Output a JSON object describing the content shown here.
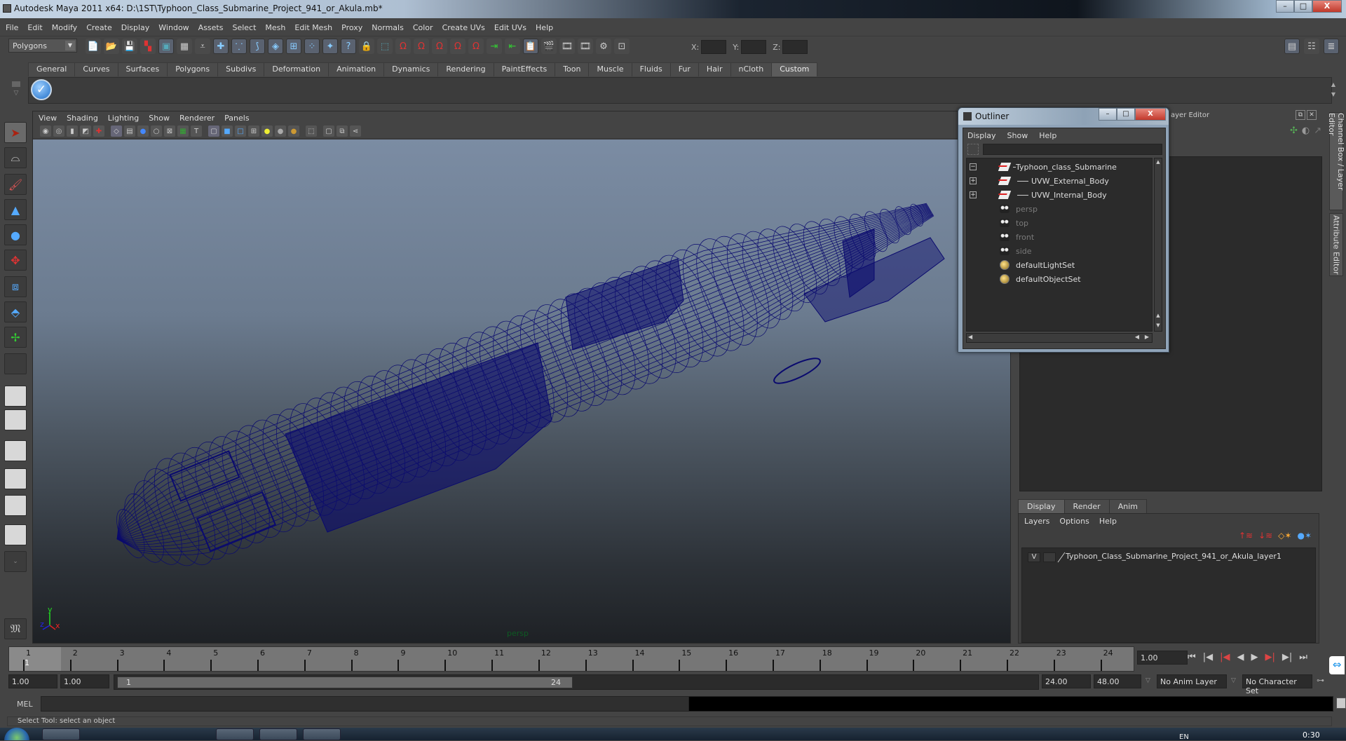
{
  "window": {
    "title": "Autodesk Maya 2011 x64: D:\\1ST\\Typhoon_Class_Submarine_Project_941_or_Akula.mb*",
    "controls": {
      "minimize": "–",
      "maximize": "□",
      "close": "X"
    }
  },
  "menubar": [
    "File",
    "Edit",
    "Modify",
    "Create",
    "Display",
    "Window",
    "Assets",
    "Select",
    "Mesh",
    "Edit Mesh",
    "Proxy",
    "Normals",
    "Color",
    "Create UVs",
    "Edit UVs",
    "Help"
  ],
  "statusline": {
    "mode": "Polygons",
    "icons": [
      "new-scene-icon",
      "open-scene-icon",
      "save-scene-icon",
      "select-by-hierarchy-icon",
      "select-by-object-icon",
      "select-by-component-icon",
      "snap-mode-icon",
      "cross-icon",
      "vertex-icon",
      "curve-icon",
      "face-icon",
      "grid-icon",
      "dots-icon",
      "particle-icon",
      "help-icon",
      "lock-icon",
      "selection-mask-icon",
      "snap-grid-icon",
      "snap-curve-icon",
      "snap-point-icon",
      "snap-view-plane-icon",
      "snap-live-icon",
      "input-ops-icon",
      "output-ops-icon",
      "history-icon",
      "render-view-icon",
      "render-frame-icon",
      "ipr-render-icon",
      "render-settings-icon"
    ],
    "xyz": {
      "x_label": "X:",
      "y_label": "Y:",
      "z_label": "Z:",
      "x": "",
      "y": "",
      "z": ""
    }
  },
  "shelf": {
    "tabs": [
      "General",
      "Curves",
      "Surfaces",
      "Polygons",
      "Subdivs",
      "Deformation",
      "Animation",
      "Dynamics",
      "Rendering",
      "PaintEffects",
      "Toon",
      "Muscle",
      "Fluids",
      "Fur",
      "Hair",
      "nCloth",
      "Custom"
    ],
    "active_tab": "Custom",
    "items": [
      "checkmark-script-icon"
    ]
  },
  "toolbox": {
    "tools": [
      "select-tool",
      "lasso-tool",
      "paint-select-tool",
      "move-tool",
      "rotate-tool",
      "scale-tool",
      "universal-manipulator",
      "soft-modify-tool",
      "show-manipulator",
      "last-tool"
    ],
    "layouts": [
      "single-perspective",
      "four-view",
      "persp-outliner",
      "persp-graph",
      "hypershade-persp",
      "persp-graph-hypergraph"
    ]
  },
  "viewport": {
    "menu": [
      "View",
      "Shading",
      "Lighting",
      "Show",
      "Renderer",
      "Panels"
    ],
    "camera_label": "persp",
    "axis_labels": {
      "x": "x",
      "y": "y",
      "z": "z"
    },
    "wire_color": "#0a0a6e"
  },
  "outliner": {
    "title": "Outliner",
    "menu": [
      "Display",
      "Show",
      "Help"
    ],
    "filter": "",
    "items": [
      {
        "label": "Typhoon_class_Submarine",
        "type": "transform",
        "expand": "−",
        "dim": false,
        "indent": 0
      },
      {
        "label": "UVW_External_Body",
        "type": "transform",
        "expand": "+",
        "dim": false,
        "indent": 1
      },
      {
        "label": "UVW_Internal_Body",
        "type": "transform",
        "expand": "+",
        "dim": false,
        "indent": 1
      },
      {
        "label": "persp",
        "type": "camera",
        "expand": "",
        "dim": true,
        "indent": 0
      },
      {
        "label": "top",
        "type": "camera",
        "expand": "",
        "dim": true,
        "indent": 0
      },
      {
        "label": "front",
        "type": "camera",
        "expand": "",
        "dim": true,
        "indent": 0
      },
      {
        "label": "side",
        "type": "camera",
        "expand": "",
        "dim": true,
        "indent": 0
      },
      {
        "label": "defaultLightSet",
        "type": "set",
        "expand": "",
        "dim": false,
        "indent": 0
      },
      {
        "label": "defaultObjectSet",
        "type": "set",
        "expand": "",
        "dim": false,
        "indent": 0
      }
    ]
  },
  "channelbox": {
    "title_partial": "ayer Editor",
    "side_tabs": [
      "Channel Box / Layer Editor",
      "Attribute Editor"
    ]
  },
  "layers": {
    "tabs": [
      "Display",
      "Render",
      "Anim"
    ],
    "active_tab": "Display",
    "menu": [
      "Layers",
      "Options",
      "Help"
    ],
    "rows": [
      {
        "visible": "V",
        "name": "Typhoon_Class_Submarine_Project_941_or_Akula_layer1"
      }
    ]
  },
  "timeline": {
    "ticks": [
      "1",
      "2",
      "3",
      "4",
      "5",
      "6",
      "7",
      "8",
      "9",
      "10",
      "11",
      "12",
      "13",
      "14",
      "15",
      "16",
      "17",
      "18",
      "19",
      "20",
      "21",
      "22",
      "23",
      "24"
    ],
    "current_frame": "1",
    "current_time_field": "1.00",
    "playback_buttons": [
      "go-to-start",
      "step-back-key",
      "step-back-frame",
      "play-backward",
      "play-forward",
      "step-forward-frame",
      "step-forward-key",
      "go-to-end"
    ]
  },
  "range": {
    "start_time": "1.00",
    "playback_start": "1.00",
    "range_start_label": "1",
    "range_end_label": "24",
    "playback_end": "24.00",
    "end_time": "48.00",
    "anim_layer": "No Anim Layer",
    "character_set": "No Character Set"
  },
  "commandline": {
    "label": "MEL",
    "input": "",
    "output": ""
  },
  "helpline": "Select Tool: select an object",
  "taskbar": {
    "apps": [
      "chrome",
      "maya",
      "acrobat",
      "photoshop",
      "maya-active",
      "explorer",
      "teamviewer"
    ],
    "language": "EN",
    "clock": "0:30"
  }
}
